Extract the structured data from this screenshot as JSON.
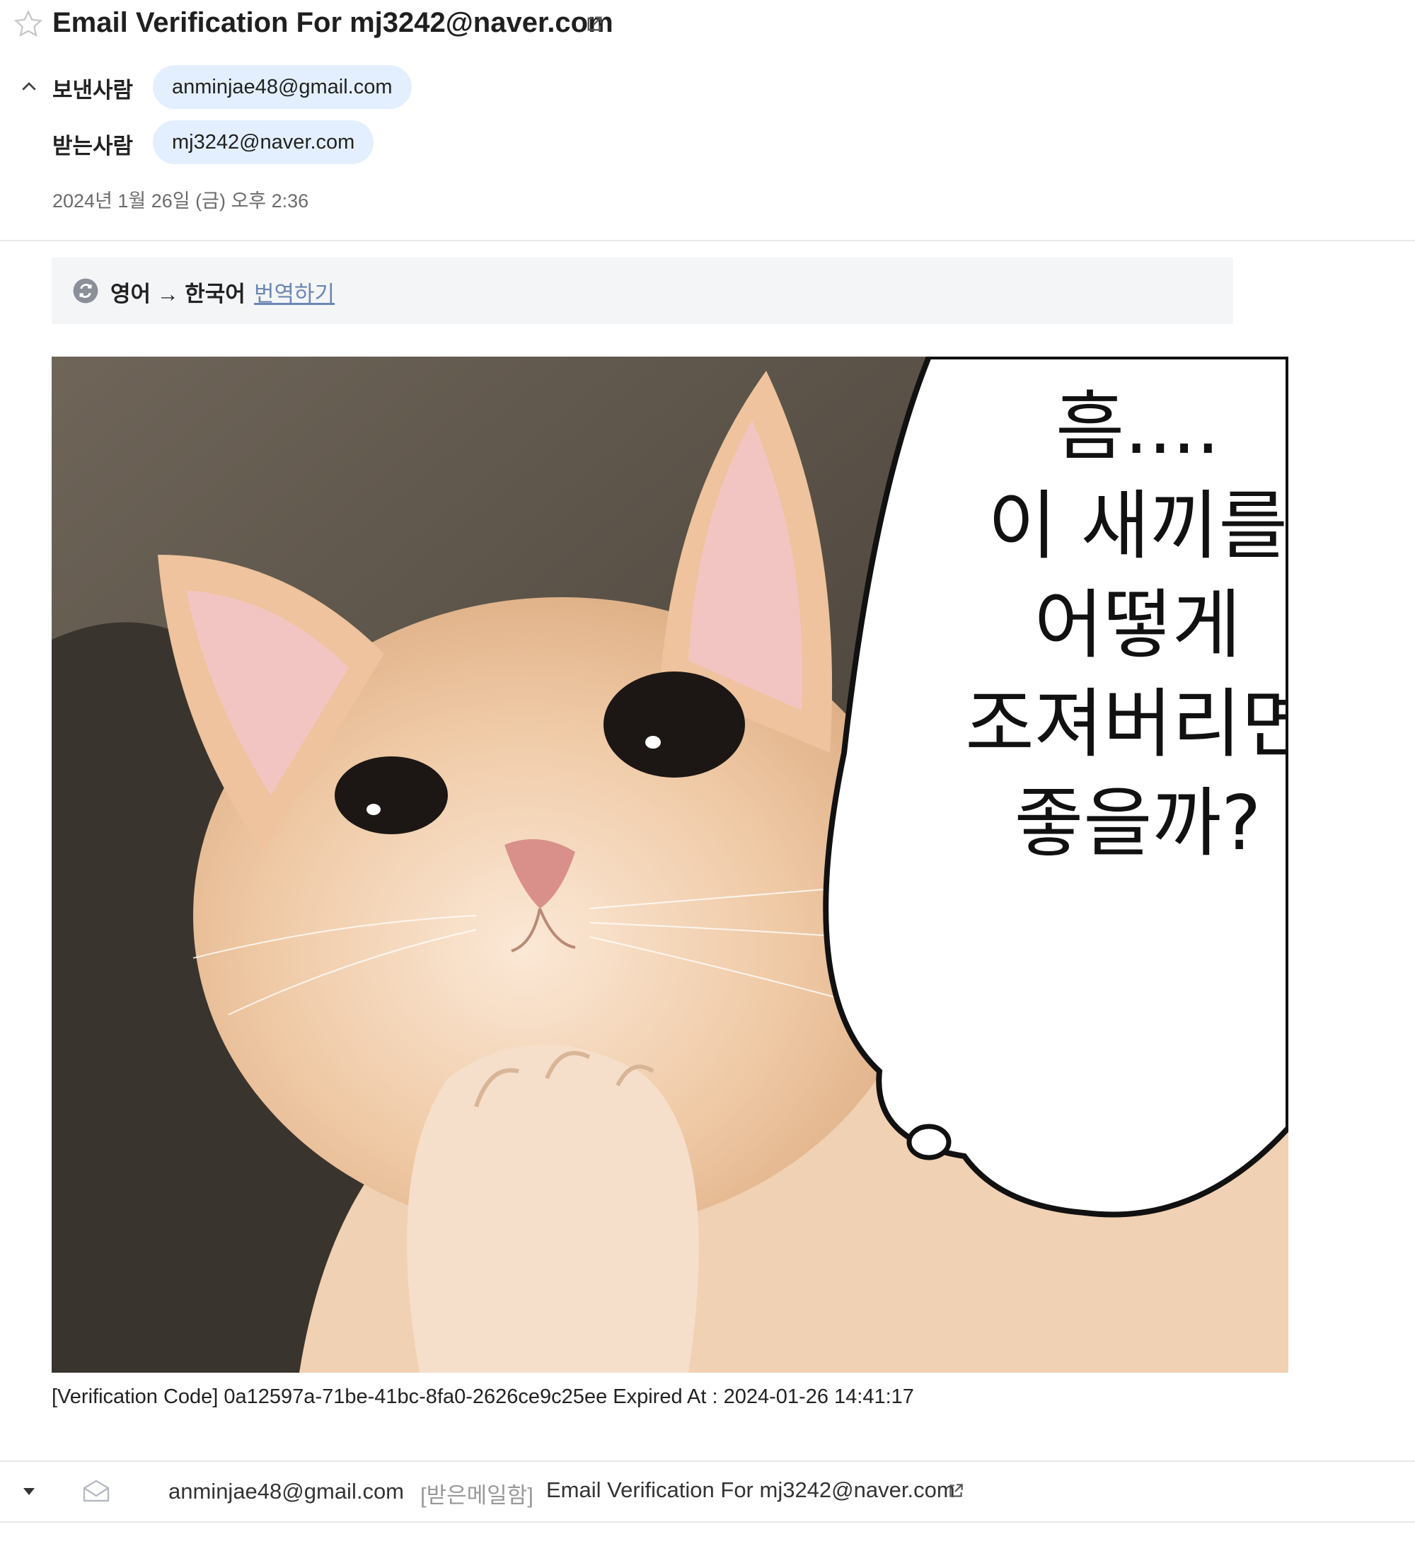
{
  "email": {
    "subject": "Email Verification For mj3242@naver.com",
    "from_label": "보낸사람",
    "from_address": "anminjae48@gmail.com",
    "to_label": "받는사람",
    "to_address": "mj3242@naver.com",
    "date": "2024년 1월 26일 (금) 오후 2:36"
  },
  "translate": {
    "languages": "영어 → 한국어",
    "action": "번역하기"
  },
  "image": {
    "bubble_lines": [
      "흠....",
      "이 새끼를",
      "어떻게",
      "조져버리면",
      "좋을까?"
    ]
  },
  "body": {
    "verification_text": "[Verification Code] 0a12597a-71be-41bc-8fa0-2626ce9c25ee Expired At : 2024-01-26 14:41:17"
  },
  "thread_row": {
    "sender": "anminjae48@gmail.com",
    "folder": "[받은메일함]",
    "subject": "Email Verification For mj3242@naver.com"
  },
  "icons": [
    "star-icon",
    "external-link-icon",
    "chevron-up-icon",
    "translate-icon",
    "caret-down-icon",
    "envelope-icon"
  ],
  "colors": {
    "chip_bg": "#e3efff",
    "translate_bar_bg": "#f4f5f7",
    "link": "#6b87b5"
  }
}
